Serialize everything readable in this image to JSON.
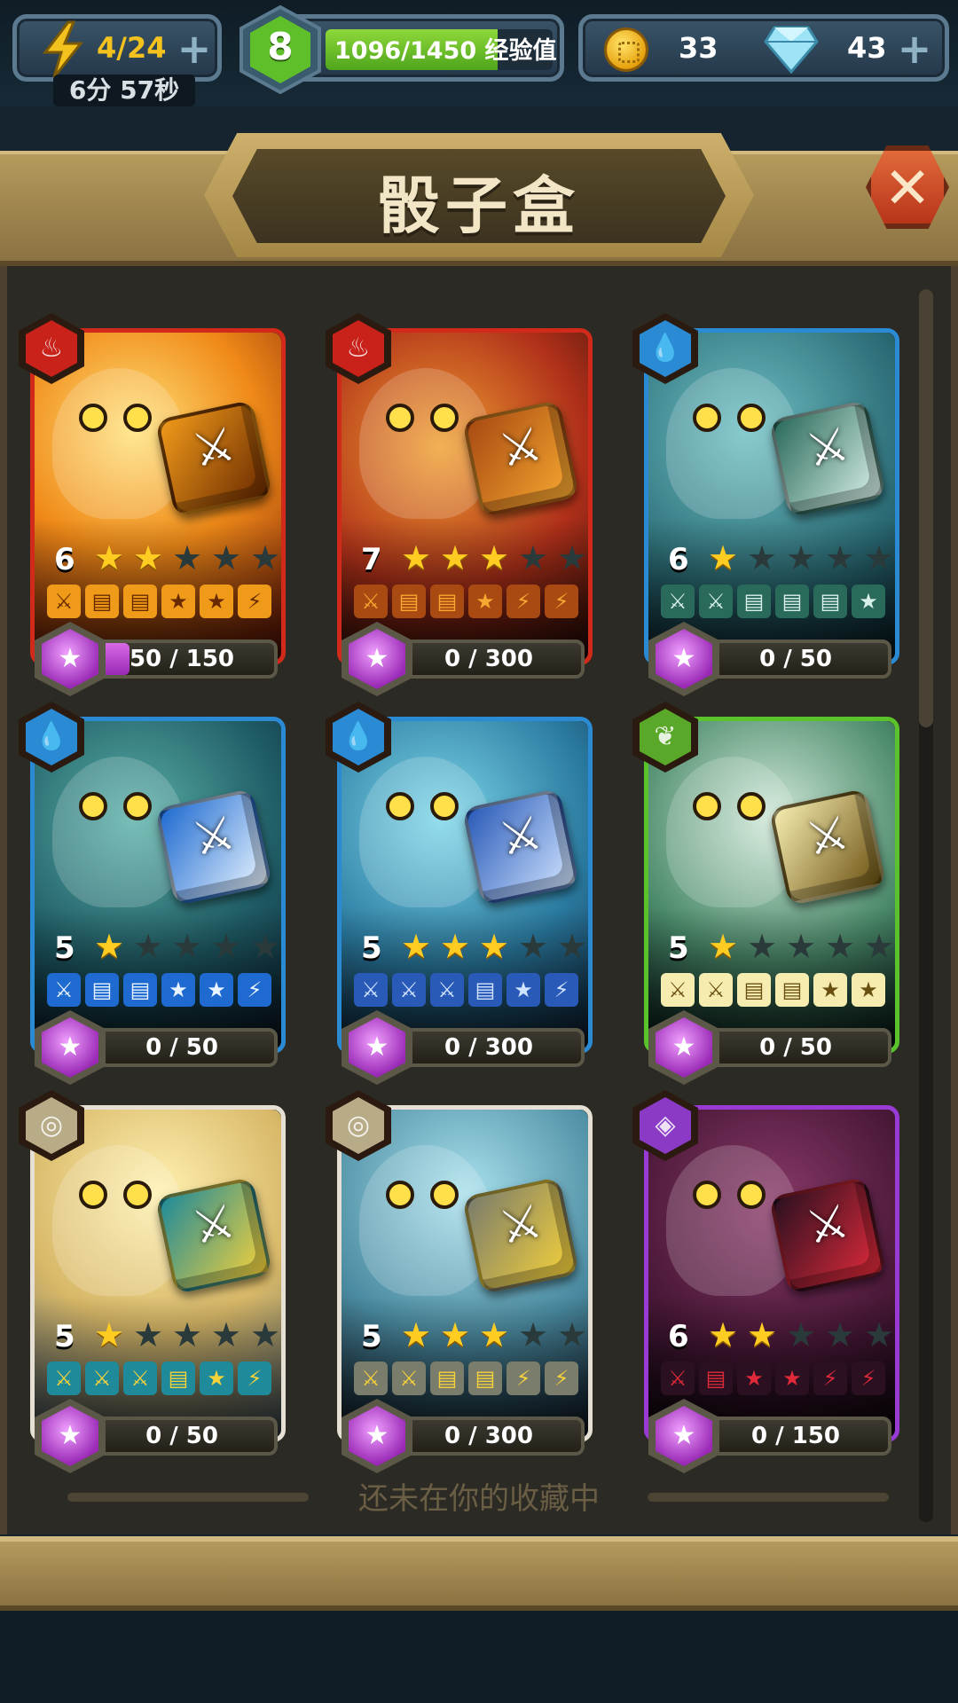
{
  "topbar": {
    "energy": "4/24",
    "energy_timer": "6分 57秒",
    "level": "8",
    "xp_text": "1096/1450 经验值",
    "xp_progress": 0.756,
    "coins": "33",
    "gems": "43"
  },
  "header": {
    "title": "骰子盒"
  },
  "cards": [
    {
      "element": "fire",
      "level": "6",
      "stars": 2,
      "progress": "50 / 150",
      "progress_ratio": 0.333,
      "faces": [
        "⚔",
        "▤",
        "▤",
        "★",
        "★",
        "⚡"
      ],
      "face_bg": "#f09a1a",
      "face_fg": "#6a2a00"
    },
    {
      "element": "fire",
      "level": "7",
      "stars": 3,
      "progress": "0 / 300",
      "progress_ratio": 0,
      "faces": [
        "⚔",
        "▤",
        "▤",
        "★",
        "⚡",
        "⚡"
      ],
      "face_bg": "#a84a12",
      "face_fg": "#f6a830"
    },
    {
      "element": "water",
      "level": "6",
      "stars": 1,
      "progress": "0 / 50",
      "progress_ratio": 0,
      "faces": [
        "⚔",
        "⚔",
        "▤",
        "▤",
        "▤",
        "★"
      ],
      "face_bg": "#2a6a5a",
      "face_fg": "#d8f0ea"
    },
    {
      "element": "water",
      "level": "5",
      "stars": 1,
      "progress": "0 / 50",
      "progress_ratio": 0,
      "faces": [
        "⚔",
        "▤",
        "▤",
        "★",
        "★",
        "⚡"
      ],
      "face_bg": "#1e6ad0",
      "face_fg": "#e8f4ff"
    },
    {
      "element": "water",
      "level": "5",
      "stars": 3,
      "progress": "0 / 300",
      "progress_ratio": 0,
      "faces": [
        "⚔",
        "⚔",
        "⚔",
        "▤",
        "★",
        "⚡"
      ],
      "face_bg": "#2a5ab8",
      "face_fg": "#d0e4ff"
    },
    {
      "element": "leaf",
      "level": "5",
      "stars": 1,
      "progress": "0 / 50",
      "progress_ratio": 0,
      "faces": [
        "⚔",
        "⚔",
        "▤",
        "▤",
        "★",
        "★"
      ],
      "face_bg": "#f6ecb0",
      "face_fg": "#6a5010"
    },
    {
      "element": "wind",
      "level": "5",
      "stars": 1,
      "progress": "0 / 50",
      "progress_ratio": 0,
      "faces": [
        "⚔",
        "⚔",
        "⚔",
        "▤",
        "★",
        "⚡"
      ],
      "face_bg": "#1e8a9a",
      "face_fg": "#f6d23a"
    },
    {
      "element": "wind",
      "level": "5",
      "stars": 3,
      "progress": "0 / 300",
      "progress_ratio": 0,
      "faces": [
        "⚔",
        "⚔",
        "▤",
        "▤",
        "⚡",
        "⚡"
      ],
      "face_bg": "#7a7c6c",
      "face_fg": "#f6d23a"
    },
    {
      "element": "dark",
      "level": "6",
      "stars": 2,
      "progress": "0 / 150",
      "progress_ratio": 0,
      "faces": [
        "⚔",
        "▤",
        "★",
        "★",
        "⚡",
        "⚡"
      ],
      "face_bg": "#2a1020",
      "face_fg": "#e02a3a"
    }
  ],
  "footer": {
    "notice": "还未在你的收藏中"
  },
  "colors": {
    "fire": "#c8221a",
    "water": "#2a8ad4",
    "leaf": "#5aa82a",
    "wind": "#b8ac88",
    "dark": "#8a3ac4",
    "star_on": "#ffcc22",
    "shard": "#b044d0"
  }
}
